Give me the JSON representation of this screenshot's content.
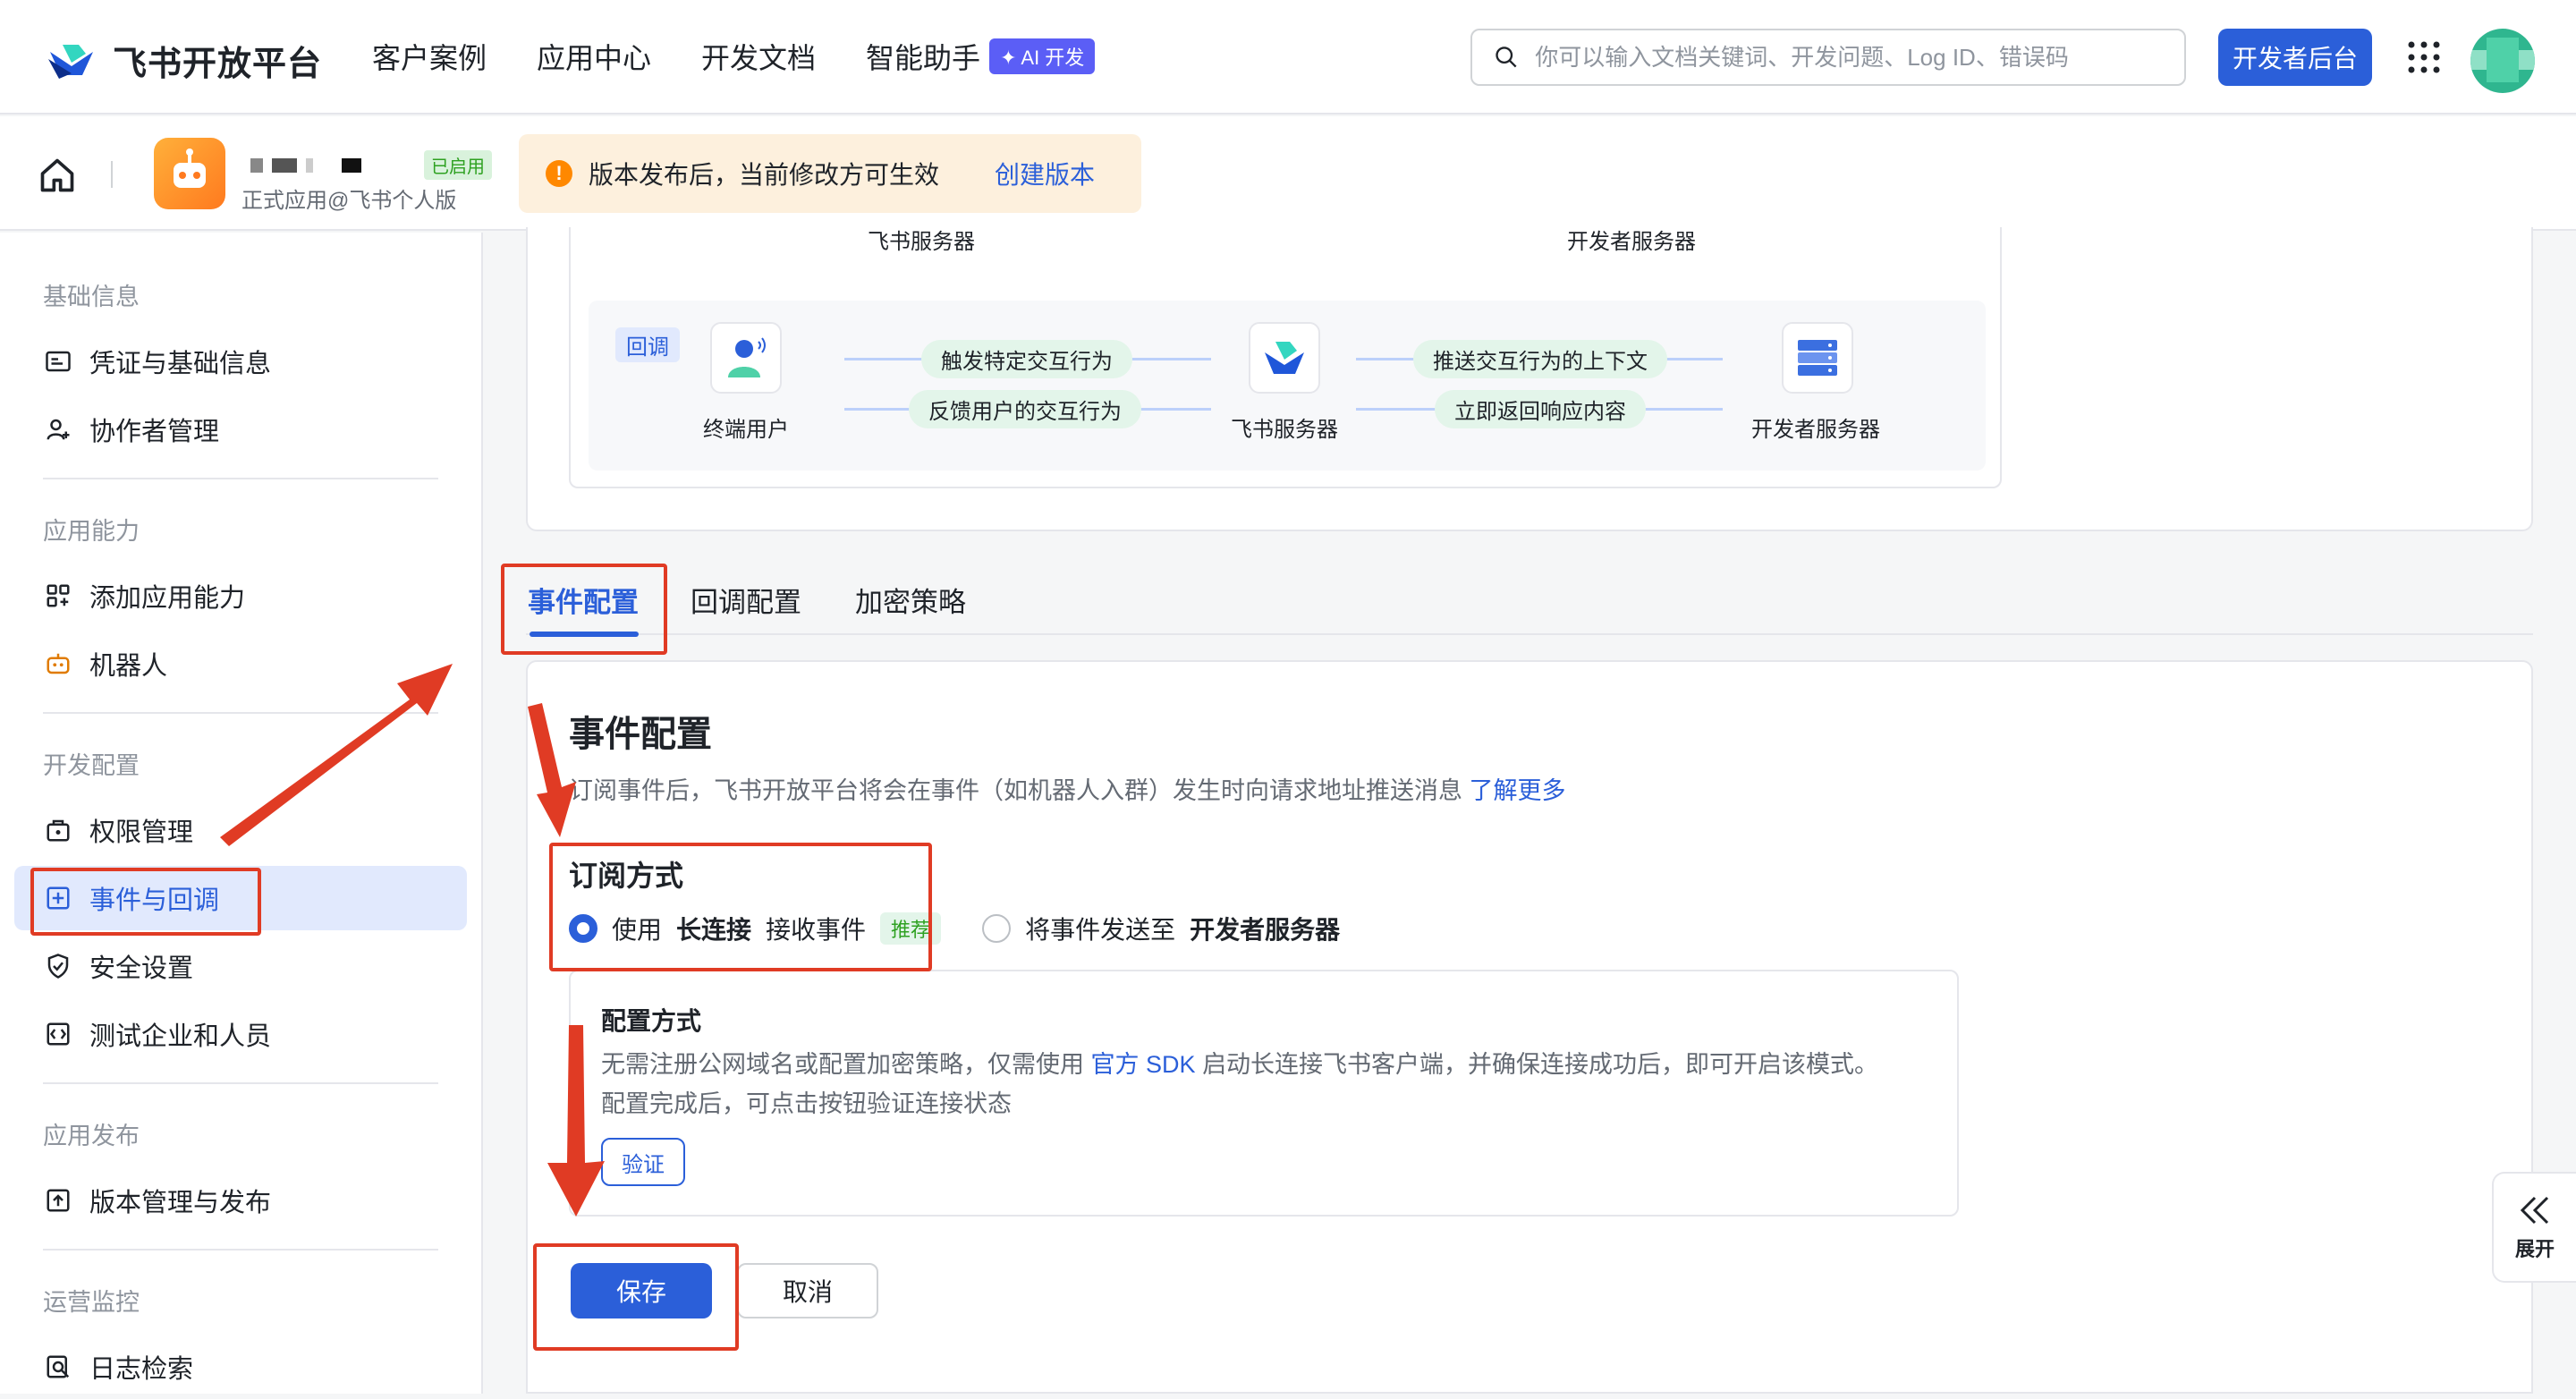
{
  "top_nav": {
    "brand": "飞书开放平台",
    "items": [
      {
        "label": "客户案例"
      },
      {
        "label": "应用中心"
      },
      {
        "label": "开发文档"
      },
      {
        "label": "智能助手"
      }
    ],
    "ai_badge": "✦ AI 开发",
    "search_placeholder": "你可以输入文档关键词、开发问题、Log ID、错误码",
    "dev_console_label": "开发者后台",
    "icons": {
      "search": "search-icon",
      "apps": "apps-grid-icon",
      "avatar": "user-avatar"
    },
    "colors": {
      "primary": "#2b5fd9",
      "ai": "#5b5ef6"
    }
  },
  "app_header": {
    "status": "已启用",
    "subtitle": "正式应用@飞书个人版",
    "notice_text": "版本发布后，当前修改方可生效",
    "notice_link": "创建版本"
  },
  "sidebar": {
    "groups": [
      {
        "title": "基础信息",
        "items": [
          {
            "label": "凭证与基础信息",
            "icon": "id-card-icon"
          },
          {
            "label": "协作者管理",
            "icon": "user-add-icon"
          }
        ]
      },
      {
        "title": "应用能力",
        "items": [
          {
            "label": "添加应用能力",
            "icon": "apps-add-icon"
          },
          {
            "label": "机器人",
            "icon": "robot-icon"
          }
        ]
      },
      {
        "title": "开发配置",
        "items": [
          {
            "label": "权限管理",
            "icon": "lock-box-icon"
          },
          {
            "label": "事件与回调",
            "icon": "event-icon",
            "active": true
          },
          {
            "label": "安全设置",
            "icon": "shield-icon"
          },
          {
            "label": "测试企业和人员",
            "icon": "code-box-icon"
          }
        ]
      },
      {
        "title": "应用发布",
        "items": [
          {
            "label": "版本管理与发布",
            "icon": "upload-box-icon"
          }
        ]
      },
      {
        "title": "运营监控",
        "items": [
          {
            "label": "日志检索",
            "icon": "log-search-icon"
          }
        ]
      }
    ]
  },
  "diagram": {
    "top_labels": [
      "飞书服务器",
      "开发者服务器"
    ],
    "callback_tag": "回调",
    "nodes": [
      "终端用户",
      "飞书服务器",
      "开发者服务器"
    ],
    "pills": [
      "触发特定交互行为",
      "反馈用户的交互行为",
      "推送交互行为的上下文",
      "立即返回响应内容"
    ]
  },
  "tabs": [
    {
      "label": "事件配置",
      "active": true
    },
    {
      "label": "回调配置"
    },
    {
      "label": "加密策略"
    }
  ],
  "event_config": {
    "title": "事件配置",
    "desc": "订阅事件后，飞书开放平台将会在事件（如机器人入群）发生时向请求地址推送消息",
    "desc_link": "了解更多",
    "subscribe_title": "订阅方式",
    "option1_pre": "使用",
    "option1_bold": "长连接",
    "option1_post": "接收事件",
    "option1_tag": "推荐",
    "option2_pre": "将事件发送至",
    "option2_bold": "开发者服务器",
    "cfg_title": "配置方式",
    "cfg_desc1_a": "无需注册公网域名或配置加密策略，仅需使用",
    "cfg_desc1_link": "官方 SDK",
    "cfg_desc1_b": "启动长连接飞书客户端，并确保连接成功后，即可开启该模式。",
    "cfg_desc2": "配置完成后，可点击按钮验证连接状态",
    "verify_label": "验证",
    "save_label": "保存",
    "cancel_label": "取消"
  },
  "expand": {
    "label": "展开",
    "icon": "double-chevron-left-icon"
  }
}
